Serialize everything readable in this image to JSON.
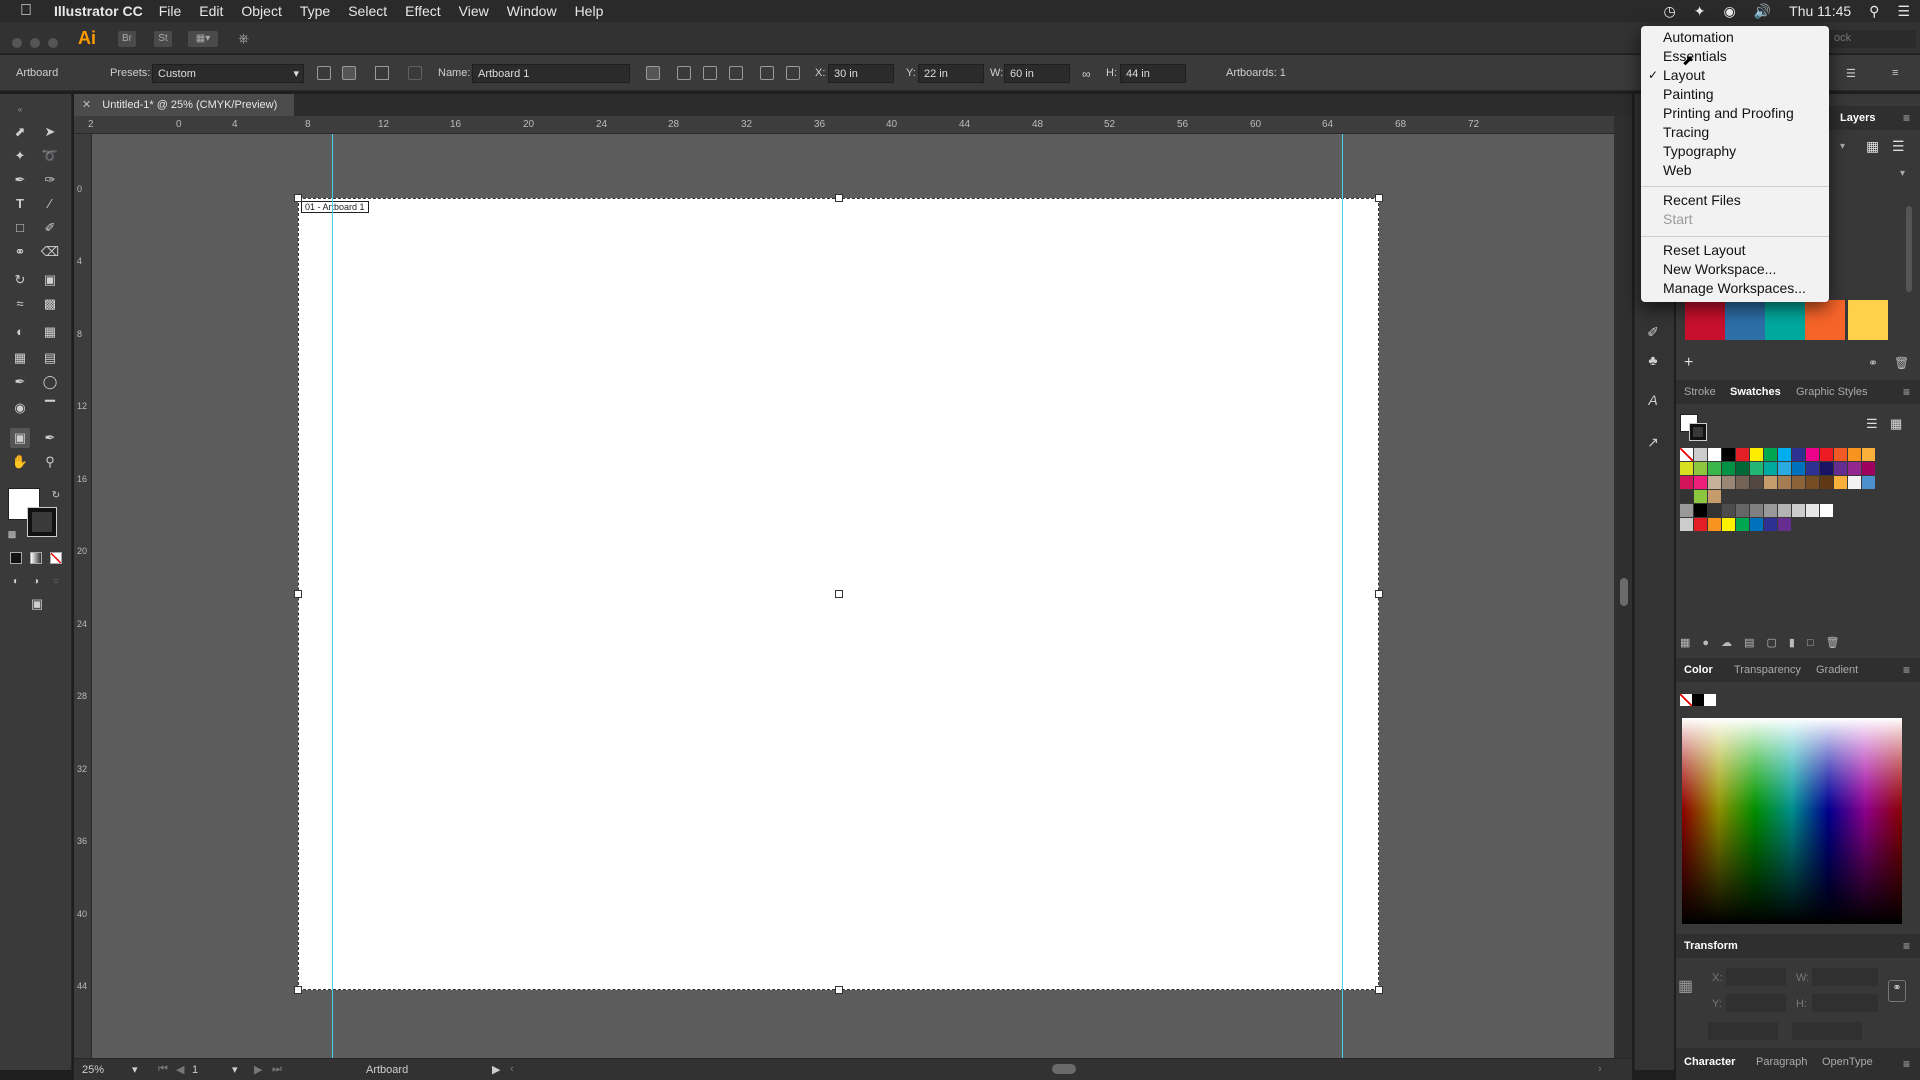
{
  "menubar": {
    "app_name": "Illustrator CC",
    "items": [
      "File",
      "Edit",
      "Object",
      "Type",
      "Select",
      "Effect",
      "View",
      "Window",
      "Help"
    ],
    "clock": "Thu 11:45"
  },
  "appbar": {
    "logo": "Ai",
    "bridge": "Br",
    "stock": "St",
    "search_placeholder": "ock"
  },
  "control": {
    "context": "Artboard",
    "presets_label": "Presets:",
    "presets_value": "Custom",
    "name_label": "Name:",
    "name_value": "Artboard 1",
    "x_label": "X:",
    "x_value": "30 in",
    "y_label": "Y:",
    "y_value": "22 in",
    "w_label": "W:",
    "w_value": "60 in",
    "h_label": "H:",
    "h_value": "44 in",
    "artboards_label": "Artboards: 1"
  },
  "document": {
    "tab_title": "Untitled-1* @ 25% (CMYK/Preview)",
    "artboard_label": "01 - Artboard 1"
  },
  "ruler": {
    "h_ticks": [
      "2",
      "0",
      "4",
      "8",
      "12",
      "16",
      "20",
      "24",
      "28",
      "32",
      "36",
      "40",
      "44",
      "48",
      "52",
      "56",
      "60",
      "64",
      "68",
      "72"
    ],
    "v_ticks": [
      "0",
      "4",
      "8",
      "12",
      "16",
      "20",
      "24",
      "28",
      "32",
      "36",
      "40",
      "44"
    ]
  },
  "status": {
    "zoom": "25%",
    "page": "1",
    "tool": "Artboard"
  },
  "workspace_menu": {
    "items": [
      "Automation",
      "Essentials",
      "Layout",
      "Painting",
      "Printing and Proofing",
      "Tracing",
      "Typography",
      "Web"
    ],
    "checked": "Layout",
    "recent": "Recent Files",
    "start": "Start",
    "reset": "Reset Layout",
    "new": "New Workspace...",
    "manage": "Manage Workspaces..."
  },
  "panels": {
    "layers_tab": "Layers",
    "swatch_tabs": [
      "Stroke",
      "Swatches",
      "Graphic Styles"
    ],
    "color_tabs": [
      "Color",
      "Transparency",
      "Gradient"
    ],
    "transform_tab": "Transform",
    "char_tabs": [
      "Character",
      "Paragraph",
      "OpenType"
    ],
    "transform_fields": {
      "x": "X:",
      "y": "Y:",
      "w": "W:",
      "h": "H:"
    }
  },
  "colors": {
    "accent_guide": "#41d3e6",
    "recent_swatches": [
      "#c8102e",
      "#2c6ea6",
      "#00a99d",
      "#f7642a",
      "#ffd04b"
    ]
  }
}
